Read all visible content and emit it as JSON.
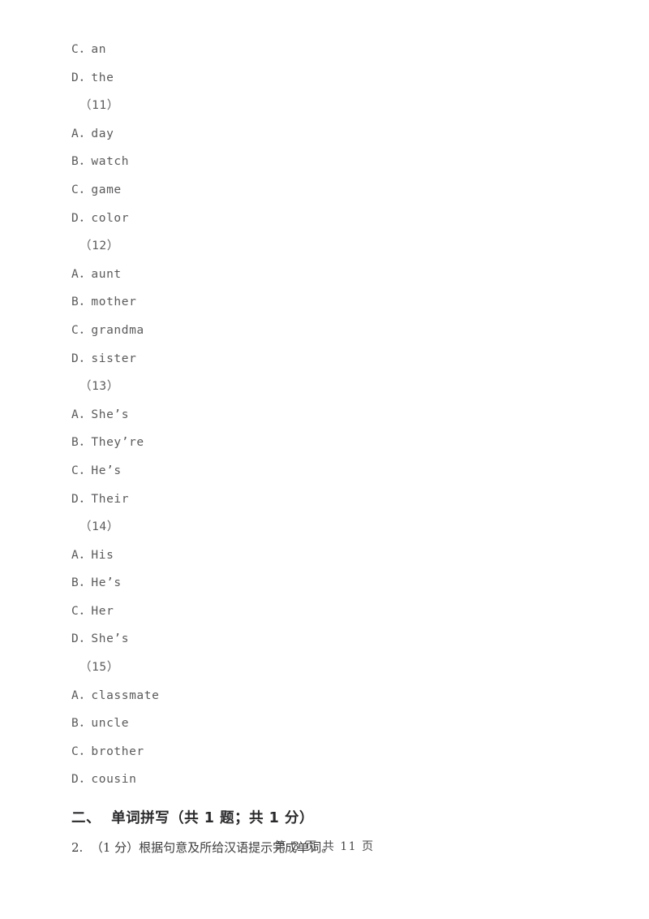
{
  "document": {
    "lines": [
      {
        "kind": "option",
        "text": "C．an"
      },
      {
        "kind": "option",
        "text": "D．the"
      },
      {
        "kind": "marker",
        "text": "（11）"
      },
      {
        "kind": "option",
        "text": "A．day"
      },
      {
        "kind": "option",
        "text": "B．watch"
      },
      {
        "kind": "option",
        "text": "C．game"
      },
      {
        "kind": "option",
        "text": "D．color"
      },
      {
        "kind": "marker",
        "text": "（12）"
      },
      {
        "kind": "option",
        "text": "A．aunt"
      },
      {
        "kind": "option",
        "text": "B．mother"
      },
      {
        "kind": "option",
        "text": "C．grandma"
      },
      {
        "kind": "option",
        "text": "D．sister"
      },
      {
        "kind": "marker",
        "text": "（13）"
      },
      {
        "kind": "option",
        "text": "A．She’s"
      },
      {
        "kind": "option",
        "text": "B．They’re"
      },
      {
        "kind": "option",
        "text": "C．He’s"
      },
      {
        "kind": "option",
        "text": "D．Their"
      },
      {
        "kind": "marker",
        "text": "（14）"
      },
      {
        "kind": "option",
        "text": "A．His"
      },
      {
        "kind": "option",
        "text": "B．He’s"
      },
      {
        "kind": "option",
        "text": "C．Her"
      },
      {
        "kind": "option",
        "text": "D．She’s"
      },
      {
        "kind": "marker",
        "text": "（15）"
      },
      {
        "kind": "option",
        "text": "A．classmate"
      },
      {
        "kind": "option",
        "text": "B．uncle"
      },
      {
        "kind": "option",
        "text": "C．brother"
      },
      {
        "kind": "option",
        "text": "D．cousin"
      }
    ],
    "section_heading": "二、  单词拼写（共 1 题；共 1 分）",
    "question": "2.  （1 分）根据句意及所给汉语提示完成单词。",
    "footer": "第 3 页 共 11 页"
  }
}
